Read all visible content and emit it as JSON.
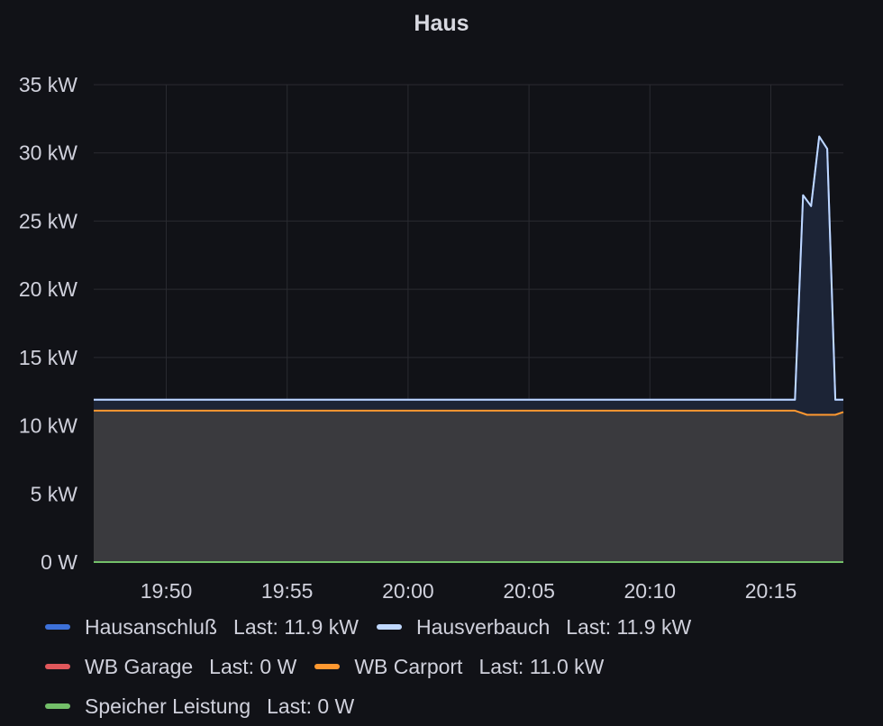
{
  "chart_data": {
    "type": "area",
    "title": "Haus",
    "time_range": [
      "19:47",
      "20:18"
    ],
    "y_ticks": [
      "0 W",
      "5 kW",
      "10 kW",
      "15 kW",
      "20 kW",
      "25 kW",
      "30 kW",
      "35 kW"
    ],
    "x_ticks": [
      "19:50",
      "19:55",
      "20:00",
      "20:05",
      "20:10",
      "20:15"
    ],
    "ylim": [
      0,
      35
    ],
    "grid": true,
    "legend_position": "bottom",
    "series": [
      {
        "name": "Hausanschluß",
        "color": "#3d71d9",
        "last": "Last: 11.9 kW",
        "points": [
          [
            "19:47",
            11.9
          ],
          [
            "20:16",
            11.9
          ],
          [
            "20:16:20",
            26.9
          ],
          [
            "20:16:40",
            26.1
          ],
          [
            "20:17:00",
            31.2
          ],
          [
            "20:17:20",
            30.3
          ],
          [
            "20:17:40",
            11.9
          ],
          [
            "20:18",
            11.9
          ]
        ]
      },
      {
        "name": "Hausverbauch",
        "color": "#c0d8ff",
        "last": "Last: 11.9 kW",
        "points": [
          [
            "19:47",
            11.9
          ],
          [
            "20:16",
            11.9
          ],
          [
            "20:16:20",
            26.9
          ],
          [
            "20:16:40",
            26.1
          ],
          [
            "20:17:00",
            31.2
          ],
          [
            "20:17:20",
            30.3
          ],
          [
            "20:17:40",
            11.9
          ],
          [
            "20:18",
            11.9
          ]
        ]
      },
      {
        "name": "WB Garage",
        "color": "#e0575b",
        "last": "Last: 0 W",
        "points": [
          [
            "19:47",
            0
          ],
          [
            "20:18",
            0
          ]
        ]
      },
      {
        "name": "WB Carport",
        "color": "#ff9830",
        "last": "Last: 11.0 kW",
        "points": [
          [
            "19:47",
            11.1
          ],
          [
            "20:16",
            11.1
          ],
          [
            "20:16:30",
            10.8
          ],
          [
            "20:17:40",
            10.8
          ],
          [
            "20:18",
            11.0
          ]
        ]
      },
      {
        "name": "Speicher Leistung",
        "color": "#73bf69",
        "last": "Last: 0 W",
        "points": [
          [
            "19:47",
            0
          ],
          [
            "20:18",
            0
          ]
        ]
      }
    ]
  }
}
